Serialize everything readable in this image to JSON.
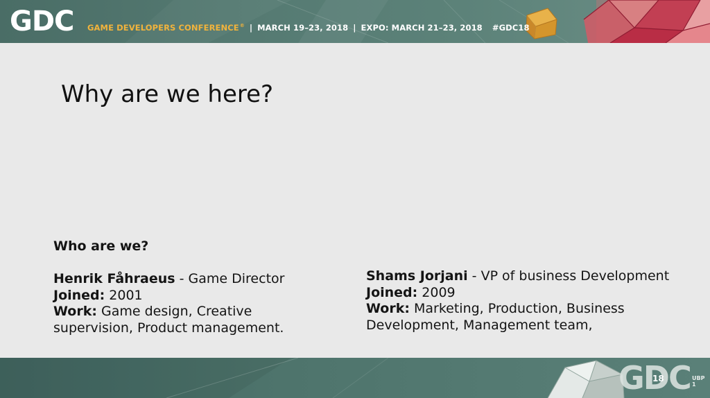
{
  "header": {
    "logo": "GDC",
    "conference_name": "GAME DEVELOPERS CONFERENCE",
    "registered_mark": "®",
    "dates": "MARCH 19–23, 2018",
    "expo": "EXPO: MARCH 21–23, 2018",
    "hashtag": "#GDC18",
    "separator": "|"
  },
  "slide": {
    "title": "Why are we here?",
    "section_heading": "Who are we?",
    "people": [
      {
        "name": "Henrik Fåhraeus",
        "role": "- Game Director",
        "joined_label": "Joined:",
        "joined": "2001",
        "work_label": "Work:",
        "work_line1": "Game design, Creative",
        "work_line2": "supervision, Product management."
      },
      {
        "name": "Shams Jorjani",
        "role": "- VP of business Development",
        "joined_label": "Joined:",
        "joined": "2009",
        "work_label": "Work:",
        "work_line1": "Marketing, Production, Business",
        "work_line2": "Development, Management team,"
      }
    ]
  },
  "footer": {
    "logo": "GDC",
    "year": "18",
    "watermark": "UBP 1"
  },
  "colors": {
    "banner_green": "#557a72",
    "accent_orange": "#f1b33c",
    "slide_background": "#e9e9e9",
    "polygon_red": "#c8374f",
    "cube_gold": "#e2a941"
  }
}
